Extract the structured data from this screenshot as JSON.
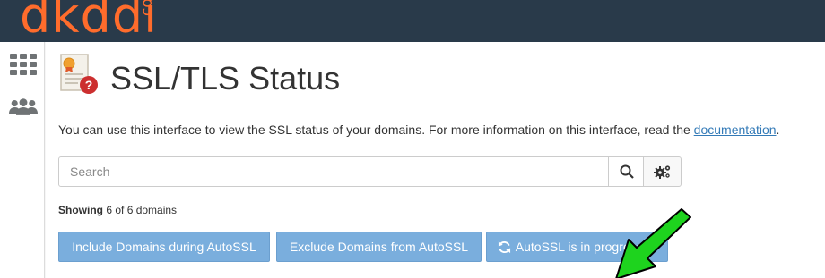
{
  "brand": {
    "logo_main": "dkddi",
    "logo_suffix": "com",
    "color": "#ff6c2c"
  },
  "sidebar": {
    "items": [
      {
        "icon": "grid-icon"
      },
      {
        "icon": "users-icon"
      }
    ]
  },
  "page": {
    "icon": "certificate-question-icon",
    "title": "SSL/TLS Status",
    "intro_text": "You can use this interface to view the SSL status of your domains. For more information on this interface, read the ",
    "intro_link": "documentation",
    "intro_end": "."
  },
  "search": {
    "placeholder": "Search",
    "value": ""
  },
  "showing": {
    "label": "Showing",
    "text": "6 of 6 domains"
  },
  "actions": {
    "include_label": "Include Domains during AutoSSL",
    "exclude_label": "Exclude Domains from AutoSSL",
    "autossl_label": "AutoSSL is in progress ..."
  },
  "colors": {
    "topbar": "#293a4a",
    "button": "#7aaedd",
    "link": "#337ab7",
    "arrow": "#1ed31e"
  }
}
